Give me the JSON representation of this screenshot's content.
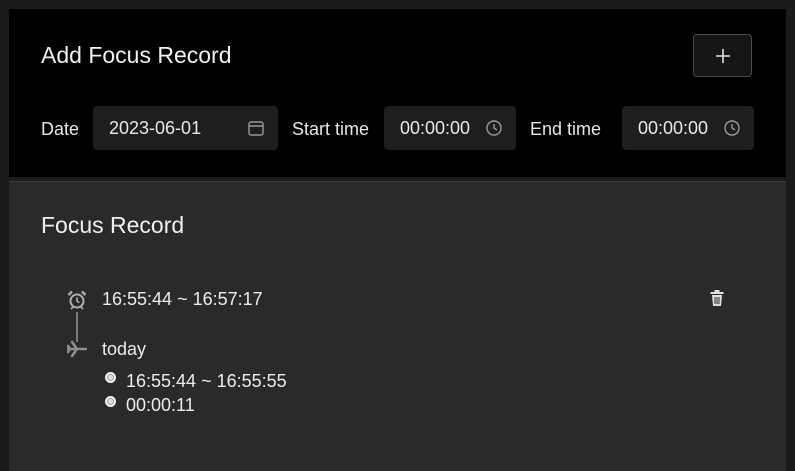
{
  "add_section": {
    "title": "Add Focus Record",
    "add_button_label": "+",
    "date_label": "Date",
    "date_value": "2023-06-01",
    "start_label": "Start time",
    "start_value": "00:00:00",
    "end_label": "End time",
    "end_value": "00:00:00"
  },
  "records_section": {
    "title": "Focus Record",
    "record": {
      "time_range": "16:55:44 ~ 16:57:17",
      "day_label": "today",
      "sessions": [
        {
          "text": "16:55:44 ~ 16:55:55"
        },
        {
          "text": "00:00:11"
        }
      ]
    }
  },
  "icons": {
    "calendar": "calendar-icon",
    "clock": "clock-icon",
    "alarm": "alarm-clock-icon",
    "plane": "airplane-icon",
    "trash": "trash-icon",
    "plus": "plus-icon"
  },
  "colors": {
    "background": "#1b1b1d",
    "top_card": "#000000",
    "records_card": "#2a2a2d",
    "input_bg": "#1e1e1e",
    "text": "#e8e8e8"
  }
}
